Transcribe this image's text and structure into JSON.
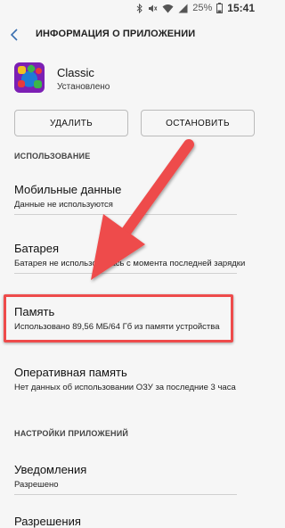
{
  "status_bar": {
    "battery_percent": "25%",
    "time": "15:41"
  },
  "header": {
    "title": "ИНФОРМАЦИЯ О ПРИЛОЖЕНИИ"
  },
  "app": {
    "name": "Classic",
    "status": "Установлено"
  },
  "buttons": {
    "delete": "УДАЛИТЬ",
    "stop": "ОСТАНОВИТЬ"
  },
  "usage": {
    "section_label": "ИСПОЛЬЗОВАНИЕ",
    "items": [
      {
        "title": "Мобильные данные",
        "subtitle": "Данные не используются"
      },
      {
        "title": "Батарея",
        "subtitle": "Батарея не использовалась с момента последней зарядки"
      },
      {
        "title": "Память",
        "subtitle": "Использовано 89,56 МБ/64 Гб из памяти устройства"
      },
      {
        "title": "Оперативная память",
        "subtitle": "Нет данных об использовании ОЗУ за последние 3 часа"
      }
    ]
  },
  "app_settings": {
    "section_label": "НАСТРОЙКИ ПРИЛОЖЕНИЙ",
    "items": [
      {
        "title": "Уведомления",
        "subtitle": "Разрешено"
      },
      {
        "title": "Разрешения"
      }
    ]
  },
  "colors": {
    "background": "#f6f6f6",
    "highlight": "#ee4b4b",
    "annotation_arrow": "#ee4b4b"
  },
  "icons": {
    "back": "chevron-left-icon",
    "bluetooth": "bluetooth-icon",
    "mute": "mute-icon",
    "wifi": "wifi-icon",
    "signal": "signal-icon",
    "battery": "battery-icon"
  }
}
